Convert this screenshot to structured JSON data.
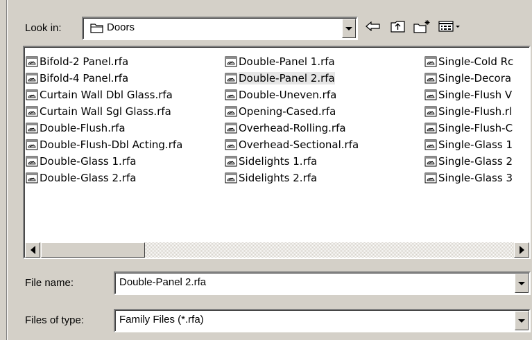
{
  "look_in": {
    "label": "Look in:",
    "value": "Doors",
    "folder_icon": "folder-icon"
  },
  "toolbar": {
    "back_icon": "back-arrow-icon",
    "up_icon": "up-one-level-icon",
    "new_folder_icon": "new-folder-icon",
    "view_menu_icon": "view-menu-icon"
  },
  "files": {
    "columns": [
      [
        "Bifold-2 Panel.rfa",
        "Bifold-4 Panel.rfa",
        "Curtain Wall Dbl Glass.rfa",
        "Curtain Wall Sgl Glass.rfa",
        "Double-Flush.rfa",
        "Double-Flush-Dbl Acting.rfa",
        "Double-Glass 1.rfa",
        "Double-Glass 2.rfa"
      ],
      [
        "Double-Panel 1.rfa",
        "Double-Panel 2.rfa",
        "Double-Uneven.rfa",
        "Opening-Cased.rfa",
        "Overhead-Rolling.rfa",
        "Overhead-Sectional.rfa",
        "Sidelights 1.rfa",
        "Sidelights 2.rfa"
      ],
      [
        "Single-Cold Rc",
        "Single-Decora",
        "Single-Flush V",
        "Single-Flush.rl",
        "Single-Flush-C",
        "Single-Glass 1",
        "Single-Glass 2",
        "Single-Glass 3"
      ]
    ],
    "selected": "Double-Panel 2.rfa",
    "file_icon": "family-file-icon"
  },
  "file_name": {
    "label": "File name:",
    "value": "Double-Panel 2.rfa"
  },
  "files_of_type": {
    "label": "Files of type:",
    "value": "Family Files (*.rfa)"
  },
  "colors": {
    "dialog_bg": "#d4d0c8",
    "list_bg": "#ffffff",
    "selection_bg": "#e6e6e6"
  }
}
